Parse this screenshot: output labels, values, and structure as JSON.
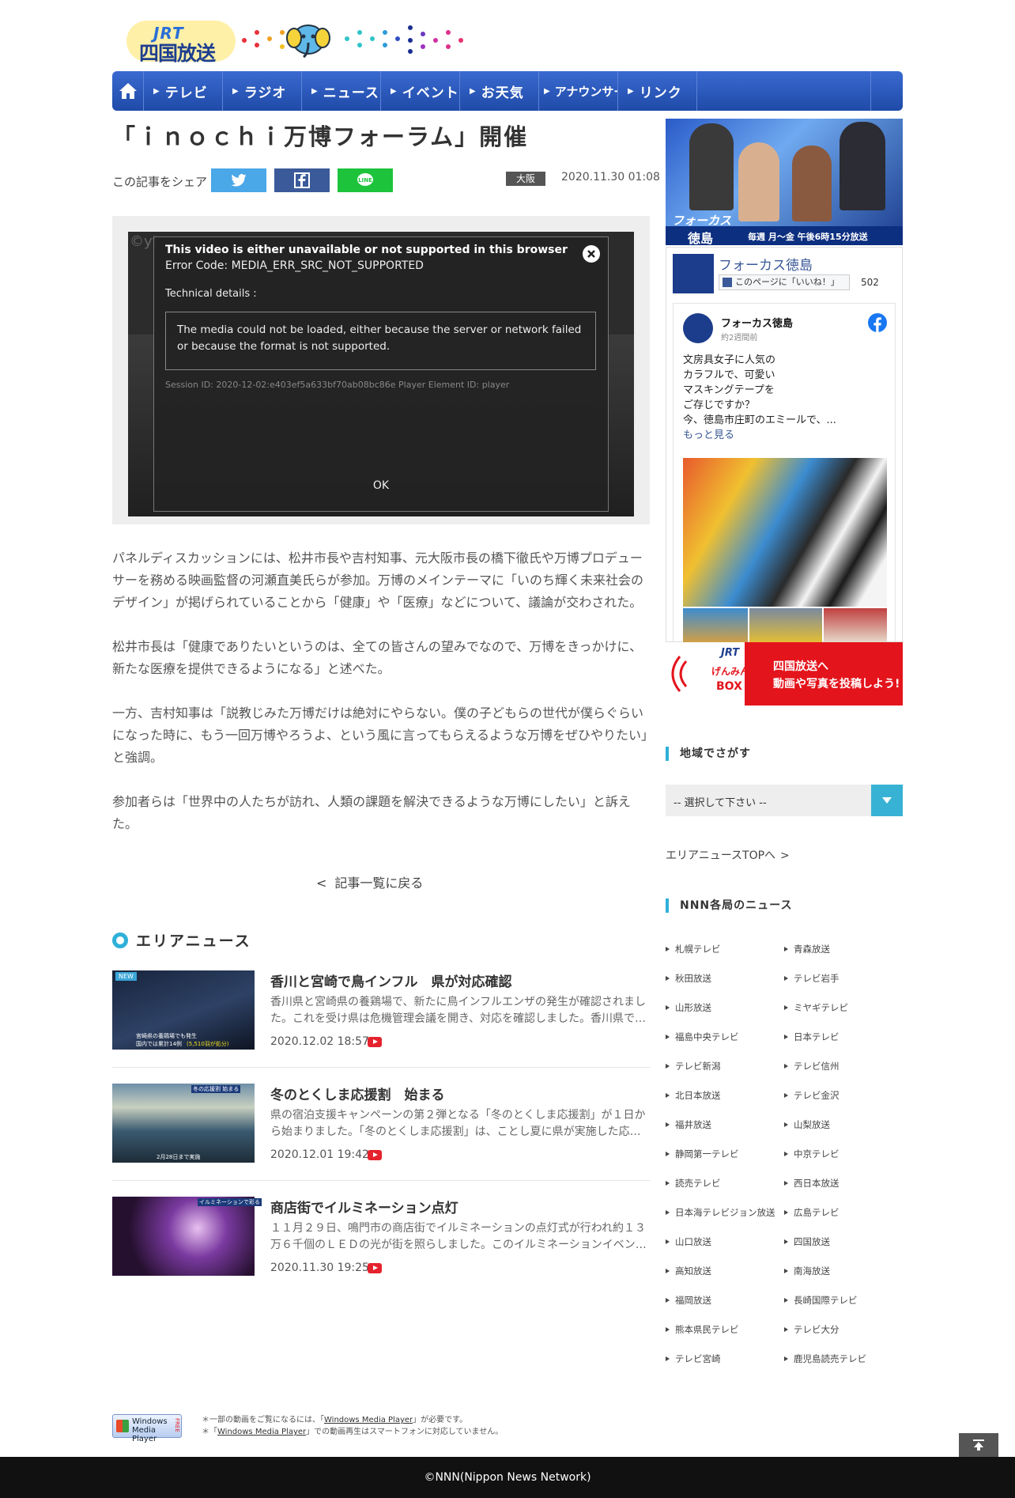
{
  "header": {
    "logo_top": "JRT",
    "logo_name": "四国放送"
  },
  "nav": {
    "items": [
      "テレビ",
      "ラジオ",
      "ニュース",
      "イベント",
      "お天気",
      "アナウンサー",
      "リンク"
    ]
  },
  "article": {
    "title": "「ｉｎｏｃｈｉ万博フォーラム」開催",
    "share_label": "この記事をシェア",
    "region_badge": "大阪",
    "date": "2020.11.30 01:08",
    "paragraphs": [
      "パネルディスカッションには、松井市長や吉村知事、元大阪市長の橋下徹氏や万博プロデューサーを務める映画監督の河瀬直美氏らが参加。万博のメインテーマに「いのち輝く未来社会のデザイン」が掲げられていることから「健康」や「医療」などについて、議論が交わされた。",
      "松井市長は「健康でありたいというのは、全ての皆さんの望みでなので、万博をきっかけに、新たな医療を提供できるようになる」と述べた。",
      "一方、吉村知事は「説教じみた万博だけは絶対にやらない。僕の子どもらの世代が僕らぐらいになった時に、もう一回万博やろうよ、という風に言ってもらえるような万博をぜひやりたい」と強調。",
      "参加者らは「世界中の人たちが訪れ、人類の課題を解決できるような万博にしたい」と訴えた。"
    ],
    "back_link": "記事一覧に戻る"
  },
  "video_error": {
    "watermark": "©yt",
    "title": "This video is either unavailable or not supported in this browser",
    "code": "Error Code: MEDIA_ERR_SRC_NOT_SUPPORTED",
    "tech_label": "Technical details :",
    "message": "The media could not be loaded, either because the server or network failed or because the format is not supported.",
    "session": "Session ID: 2020-12-02:e403ef5a633bf70ab08bc86e Player Element ID: player",
    "ok": "OK"
  },
  "area_news": {
    "heading": "エリアニュース",
    "items": [
      {
        "title": "香川と宮崎で鳥インフル　県が対応確認",
        "desc": "香川県と宮崎県の養鶏場で、新たに鳥インフルエンザの発生が確認されました。これを受け県は危機管理会議を開き、対応を確認しました。香川県で…",
        "date": "2020.12.02 18:57",
        "badge": "NEW",
        "caption1": "宮崎県の養鶏場でも発生",
        "caption2": "国内では累計14例",
        "caption3": "(5,510羽が処分)"
      },
      {
        "title": "冬のとくしま応援割　始まる",
        "desc": "県の宿泊支援キャンペーンの第２弾となる「冬のとくしま応援割」が１日から始まりました。「冬のとくしま応援割」は、ことし夏に県が実施した応…",
        "date": "2020.12.01 19:42",
        "caption1": "冬の応援割 始まる",
        "caption2": "2月28日まで実施"
      },
      {
        "title": "商店街でイルミネーション点灯",
        "desc": "１１月２９日、鳴門市の商店街でイルミネーションの点灯式が行われ約１３万６千個のＬＥＤの光が街を照らしました。このイルミネーションイベン…",
        "date": "2020.11.30 19:25",
        "caption1": "イルミネーションで彩る"
      }
    ]
  },
  "sidebar": {
    "banner": {
      "line1": "フォーカス",
      "line2": "徳島",
      "schedule": "毎週 月～金 午後6時15分放送"
    },
    "fb_page": {
      "name": "フォーカス徳島",
      "like_button": "このページに「いいね！」",
      "likes": "502",
      "post_author": "フォーカス徳島",
      "post_time": "約2週間前",
      "post_lines": [
        "文房具女子に人気の",
        "カラフルで、可愛い",
        "マスキングテープを",
        "ご存じですか？",
        "今、徳島市庄町のエミールで、..."
      ],
      "more": "もっと見る"
    },
    "genmin": {
      "jrt": "JRT",
      "name1": "げんみん",
      "name2": "BOX",
      "line1": "四国放送へ",
      "line2": "動画や写真を投稿しよう!"
    },
    "region_heading": "地域でさがす",
    "select_placeholder": "-- 選択して下さい --",
    "area_top_link": "エリアニュースTOPへ",
    "nnn_heading": "NNN各局のニュース",
    "stations": [
      "札幌テレビ",
      "青森放送",
      "秋田放送",
      "テレビ岩手",
      "山形放送",
      "ミヤギテレビ",
      "福島中央テレビ",
      "日本テレビ",
      "テレビ新潟",
      "テレビ信州",
      "北日本放送",
      "テレビ金沢",
      "福井放送",
      "山梨放送",
      "静岡第一テレビ",
      "中京テレビ",
      "読売テレビ",
      "西日本放送",
      "日本海テレビジョン放送",
      "広島テレビ",
      "山口放送",
      "四国放送",
      "高知放送",
      "南海放送",
      "福岡放送",
      "長崎国際テレビ",
      "熊本県民テレビ",
      "テレビ大分",
      "テレビ宮崎",
      "鹿児島読売テレビ"
    ]
  },
  "footer": {
    "wmp_line1": "Windows",
    "wmp_line2": "Media Player",
    "wmp_free": "FREE",
    "note1_pre": "＊一部の動画をご覧になるには、「",
    "note1_link": "Windows Media Player",
    "note1_post": "」が必要です。",
    "note2_pre": "＊「",
    "note2_link": "Windows Media Player",
    "note2_post": "」での動画再生はスマートフォンに対応していません。",
    "copyright": "©NNN(Nippon News Network)"
  },
  "colors": {
    "nav_blue": "#2a5bc4",
    "accent_cyan": "#2fb0d8",
    "youtube_red": "#e5222d",
    "twitter": "#4aa7e8",
    "facebook": "#3a5a9a",
    "line": "#1ec33c"
  }
}
